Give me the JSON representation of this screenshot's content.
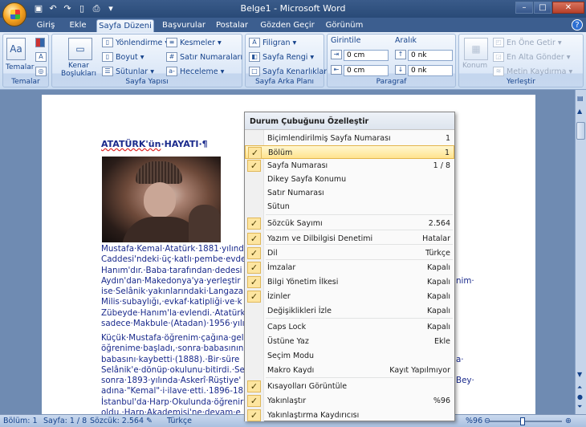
{
  "app": {
    "title": "Belge1 - Microsoft Word"
  },
  "window": {
    "minimize": "–",
    "maximize": "□",
    "close": "✕"
  },
  "tabs": [
    "Giriş",
    "Ekle",
    "Sayfa Düzeni",
    "Başvurular",
    "Postalar",
    "Gözden Geçir",
    "Görünüm"
  ],
  "ribbon": {
    "temalar": {
      "label": "Temalar",
      "group": "Temalar"
    },
    "sayfa_yapisi": {
      "kenar": "Kenar Boşlukları",
      "yonlendirme": "Yönlendirme",
      "boyut": "Boyut",
      "sutunlar": "Sütunlar",
      "kesmeler": "Kesmeler",
      "satir_numaralari": "Satır Numaraları",
      "heceleme": "Heceleme",
      "group": "Sayfa Yapısı"
    },
    "sayfa_arka_plani": {
      "filigran": "Filigran",
      "sayfa_rengi": "Sayfa Rengi",
      "sayfa_kenarliklari": "Sayfa Kenarlıkları",
      "group": "Sayfa Arka Planı"
    },
    "paragraf": {
      "girinti": "Girintile",
      "aralik": "Aralık",
      "sol": "0 cm",
      "sag": "0 cm",
      "once": "0 nk",
      "sonra": "0 nk",
      "group": "Paragraf"
    },
    "yerlestir": {
      "konum": "Konum",
      "en_one": "En Öne Getir",
      "en_alta": "En Alta Gönder",
      "metin_kaydirma": "Metin Kaydırma",
      "group": "Yerleştir"
    }
  },
  "document": {
    "title_a": "ATATÜRK'ün",
    "title_b": "·HAYATI·¶",
    "para1": [
      "Mustafa·Kemal·Atatürk·1881·yılınd",
      "Caddesi'ndeki·üç·katlı·pembe·evde",
      "Hanım'dır.·Baba·tarafından·dedesi",
      "Aydın'dan·Makedonya'ya·yerleştir",
      "ise·Selânik·yakınlarındaki·Langaza",
      "Milis·subaylığı,·evkaf·katipliği·ve·k",
      "Zübeyde·Hanım'la·evlendi.·Atatürk",
      "sadece·Makbule·(Atadan)·1956·yılı"
    ],
    "para2": [
      "Küçük·Mustafa·öğrenim·çağına·gel",
      "öğrenime·başladı,·sonra·babasının",
      "babasını·kaybetti·(1888).·Bir·süre",
      "Selânik'e·dönüp·okulunu·bitirdi.·Se",
      "sonra·1893·yılında·Askerî·Rüştiye'",
      "adına·\"Kemal\"·i·ilave·etti.·1896-18",
      "İstanbul'da·Harp·Okulunda·öğrenir",
      "oldu.·Harp·Akademisi'ne·devam·e"
    ],
    "right_frag1": "nim·",
    "right_frag2": "a·",
    "right_frag3": "Bey·"
  },
  "statusbar": {
    "bolum": "Bölüm: 1",
    "sayfa": "Sayfa: 1 / 8",
    "sozcuk": "Sözcük: 2.564",
    "dil": "Türkçe",
    "zoom": "%96",
    "zoom_value": 96
  },
  "menu": {
    "title": "Durum Çubuğunu Özelleştir",
    "items": [
      {
        "label": "Biçimlendirilmiş Sayfa Numarası",
        "value": "1",
        "checked": false
      },
      {
        "label": "Bölüm",
        "value": "1",
        "checked": true
      },
      {
        "label": "Sayfa Numarası",
        "value": "1 / 8",
        "checked": true
      },
      {
        "label": "Dikey Sayfa Konumu",
        "value": "",
        "checked": false
      },
      {
        "label": "Satır Numarası",
        "value": "",
        "checked": false
      },
      {
        "label": "Sütun",
        "value": "",
        "checked": false
      },
      {
        "label": "Sözcük Sayımı",
        "value": "2.564",
        "checked": true
      },
      {
        "label": "Yazım ve Dilbilgisi Denetimi",
        "value": "Hatalar",
        "checked": true
      },
      {
        "label": "Dil",
        "value": "Türkçe",
        "checked": true
      },
      {
        "label": "İmzalar",
        "value": "Kapalı",
        "checked": true
      },
      {
        "label": "Bilgi Yönetim İlkesi",
        "value": "Kapalı",
        "checked": true
      },
      {
        "label": "İzinler",
        "value": "Kapalı",
        "checked": true
      },
      {
        "label": "Değişiklikleri İzle",
        "value": "Kapalı",
        "checked": false
      },
      {
        "label": "Caps Lock",
        "value": "Kapalı",
        "checked": false
      },
      {
        "label": "Üstüne Yaz",
        "value": "Ekle",
        "checked": false
      },
      {
        "label": "Seçim Modu",
        "value": "",
        "checked": false
      },
      {
        "label": "Makro Kaydı",
        "value": "Kayıt Yapılmıyor",
        "checked": false
      },
      {
        "label": "Kısayolları Görüntüle",
        "value": "",
        "checked": true
      },
      {
        "label": "Yakınlaştır",
        "value": "%96",
        "checked": true
      },
      {
        "label": "Yakınlaştırma Kaydırıcısı",
        "value": "",
        "checked": true
      }
    ]
  },
  "icons": {
    "check": "✓",
    "office": "office-orb-icon"
  }
}
